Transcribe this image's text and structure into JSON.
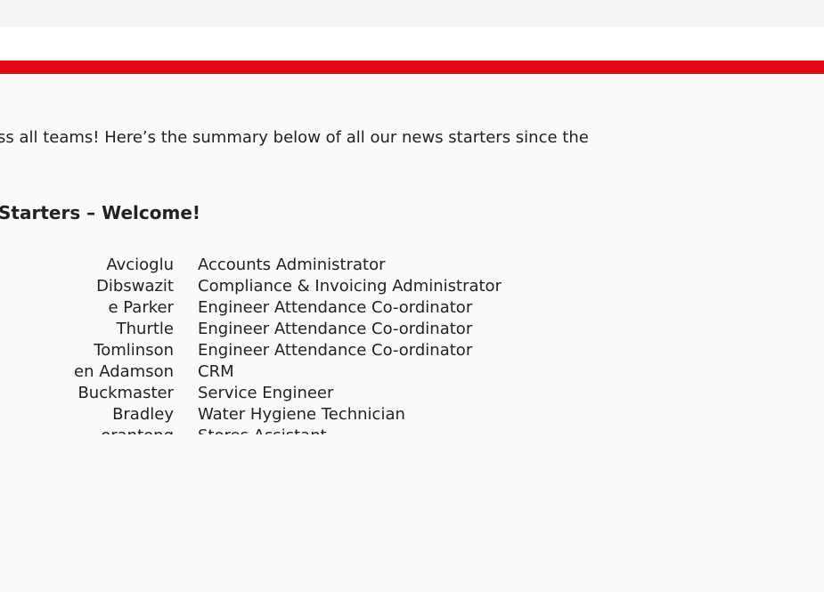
{
  "colors": {
    "accent_bar": "#e30613",
    "page_background": "#fafafb",
    "text": "#222222"
  },
  "email": {
    "intro_text": "ss all teams!  Here’s the summary below of all our news starters since the",
    "section_heading": "Starters – Welcome!",
    "starters": [
      {
        "name": "Avcioglu",
        "role": "Accounts Administrator"
      },
      {
        "name": "Dibswazit",
        "role": "Compliance & Invoicing Administrator"
      },
      {
        "name": "e Parker",
        "role": "Engineer Attendance Co-ordinator"
      },
      {
        "name": "Thurtle",
        "role": "Engineer Attendance Co-ordinator"
      },
      {
        "name": "Tomlinson",
        "role": "Engineer Attendance Co-ordinator"
      },
      {
        "name": "en Adamson",
        "role": "CRM"
      },
      {
        "name": "Buckmaster",
        "role": "Service Engineer"
      },
      {
        "name": "Bradley",
        "role": "Water Hygiene Technician"
      },
      {
        "name": "orantong",
        "role": "Stores Assistant"
      }
    ]
  }
}
